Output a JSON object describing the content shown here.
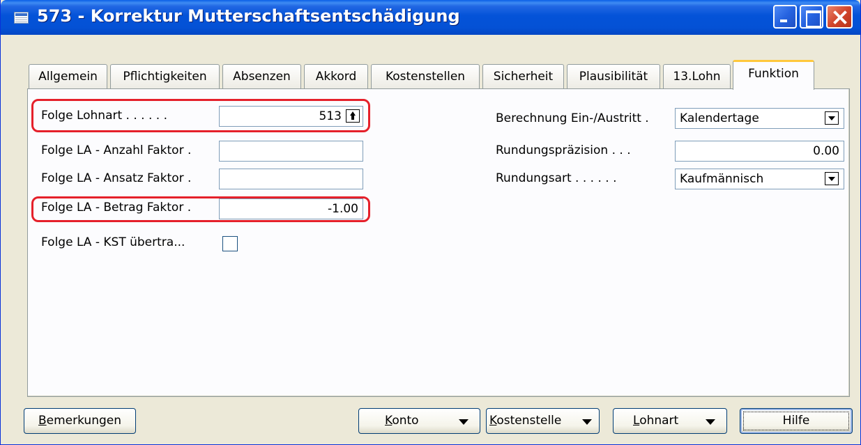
{
  "window": {
    "title": "573 - Korrektur Mutterschaftsentschädigung"
  },
  "tabs": [
    {
      "label": "Allgemein"
    },
    {
      "label": "Pflichtigkeiten"
    },
    {
      "label": "Absenzen"
    },
    {
      "label": "Akkord"
    },
    {
      "label": "Kostenstellen"
    },
    {
      "label": "Sicherheit"
    },
    {
      "label": "Plausibilität"
    },
    {
      "label": "13.Lohn"
    },
    {
      "label": "Funktion"
    }
  ],
  "active_tab": "Funktion",
  "left_fields": {
    "folge_lohnart": {
      "label": "Folge Lohnart . . . . . .",
      "value": "513"
    },
    "anzahl_faktor": {
      "label": "Folge LA - Anzahl Faktor .",
      "value": ""
    },
    "ansatz_faktor": {
      "label": "Folge LA - Ansatz Faktor .",
      "value": ""
    },
    "betrag_faktor": {
      "label": "Folge LA - Betrag Faktor .",
      "value": "-1.00"
    },
    "kst_uebertragen": {
      "label": "Folge LA - KST übertra...",
      "checked": false
    }
  },
  "right_fields": {
    "berechnung": {
      "label": "Berechnung Ein-/Austritt .",
      "value": "Kalendertage"
    },
    "rundungspraezision": {
      "label": "Rundungspräzision . . .",
      "value": "0.00"
    },
    "rundungsart": {
      "label": "Rundungsart . . . . . .",
      "value": "Kaufmännisch"
    }
  },
  "buttons": {
    "bemerkungen": {
      "prefix": "B",
      "rest": "emerkungen"
    },
    "konto": {
      "prefix": "K",
      "rest": "onto"
    },
    "kostenstelle": {
      "prefix": "K",
      "rest": "ostenstelle"
    },
    "lohnart": {
      "prefix": "L",
      "rest": "ohnart"
    },
    "hilfe": {
      "label": "Hilfe"
    }
  },
  "colors": {
    "titlebar": "#0453D8",
    "highlight": "#E5202A",
    "active_tab_accent": "#FFC83C"
  }
}
